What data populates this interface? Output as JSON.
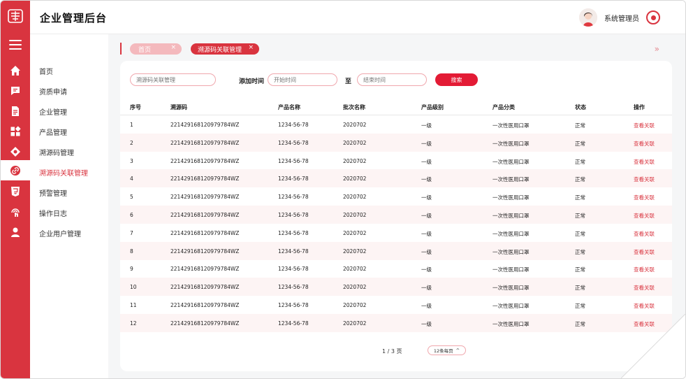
{
  "app": {
    "title": "企业管理后台"
  },
  "user": {
    "name": "系统管理员"
  },
  "rail_icons": [
    "home-icon",
    "message-icon",
    "document-icon",
    "grid-icon",
    "package-icon",
    "link-icon",
    "html5-icon",
    "touch-icon",
    "user-icon"
  ],
  "nav": {
    "items": [
      {
        "label": "首页"
      },
      {
        "label": "资质申请"
      },
      {
        "label": "企业管理"
      },
      {
        "label": "产品管理"
      },
      {
        "label": "溯源码管理"
      },
      {
        "label": "溯源码关联管理",
        "active": true
      },
      {
        "label": "预警管理"
      },
      {
        "label": "操作日志"
      },
      {
        "label": "企业用户管理"
      }
    ]
  },
  "tabs": [
    {
      "label": "首页",
      "close": "×"
    },
    {
      "label": "溯源码关联管理",
      "close": "×"
    }
  ],
  "tab_expand": "»",
  "filters": {
    "code_placeholder": "溯源码关联管理",
    "time_label": "添加时间",
    "start_placeholder": "开始时间",
    "to_label": "至",
    "end_placeholder": "结束时间",
    "search_label": "搜索"
  },
  "table": {
    "headers": [
      "序号",
      "溯源码",
      "产品名称",
      "批次名称",
      "产品级别",
      "产品分类",
      "状态",
      "操作"
    ],
    "rows": [
      [
        "1",
        "221429168120979784WZ",
        "1234-56-78",
        "2020702",
        "一级",
        "一次性医用口罩",
        "正常",
        "查看关联"
      ],
      [
        "2",
        "221429168120979784WZ",
        "1234-56-78",
        "2020702",
        "一级",
        "一次性医用口罩",
        "正常",
        "查看关联"
      ],
      [
        "3",
        "221429168120979784WZ",
        "1234-56-78",
        "2020702",
        "一级",
        "一次性医用口罩",
        "正常",
        "查看关联"
      ],
      [
        "4",
        "221429168120979784WZ",
        "1234-56-78",
        "2020702",
        "一级",
        "一次性医用口罩",
        "正常",
        "查看关联"
      ],
      [
        "5",
        "221429168120979784WZ",
        "1234-56-78",
        "2020702",
        "一级",
        "一次性医用口罩",
        "正常",
        "查看关联"
      ],
      [
        "6",
        "221429168120979784WZ",
        "1234-56-78",
        "2020702",
        "一级",
        "一次性医用口罩",
        "正常",
        "查看关联"
      ],
      [
        "7",
        "221429168120979784WZ",
        "1234-56-78",
        "2020702",
        "一级",
        "一次性医用口罩",
        "正常",
        "查看关联"
      ],
      [
        "8",
        "221429168120979784WZ",
        "1234-56-78",
        "2020702",
        "一级",
        "一次性医用口罩",
        "正常",
        "查看关联"
      ],
      [
        "9",
        "221429168120979784WZ",
        "1234-56-78",
        "2020702",
        "一级",
        "一次性医用口罩",
        "正常",
        "查看关联"
      ],
      [
        "10",
        "221429168120979784WZ",
        "1234-56-78",
        "2020702",
        "一级",
        "一次性医用口罩",
        "正常",
        "查看关联"
      ],
      [
        "11",
        "221429168120979784WZ",
        "1234-56-78",
        "2020702",
        "一级",
        "一次性医用口罩",
        "正常",
        "查看关联"
      ],
      [
        "12",
        "221429168120979784WZ",
        "1234-56-78",
        "2020702",
        "一级",
        "一次性医用口罩",
        "正常",
        "查看关联"
      ]
    ]
  },
  "pagination": {
    "info": "1 / 3 页",
    "page_size": "12条每页",
    "caret": "^"
  },
  "colors": {
    "accent": "#d9343f",
    "button": "#e31b35",
    "row_alt": "#fdf4f4"
  }
}
